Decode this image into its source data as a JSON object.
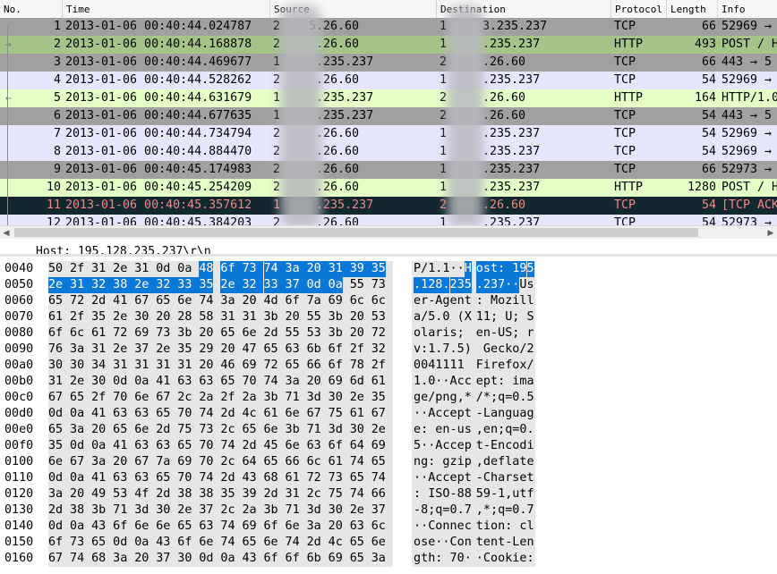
{
  "columns": [
    "No.",
    "Time",
    "Source",
    "Destination",
    "Protocol",
    "Length",
    "Info"
  ],
  "colors": {
    "row_tcp": "#e7e6ff",
    "row_http": "#e4ffc7",
    "row_gray": "#a0a0a0",
    "row_black": "#12272e",
    "row_black_text": "#f78787",
    "selection": "#0a78d7"
  },
  "packets": [
    {
      "no": "1",
      "time": "2013-01-06 00:40:44.024787",
      "source": "2    5.26.60",
      "destination": "1     3.235.237",
      "protocol": "TCP",
      "length": "66",
      "info": "52969 →",
      "style": "gray",
      "rel": ""
    },
    {
      "no": "2",
      "time": "2013-01-06 00:40:44.168878",
      "source": "2     .26.60",
      "destination": "1     .235.237",
      "protocol": "HTTP",
      "length": "493",
      "info": "POST / H",
      "style": "http_dark",
      "rel": "→"
    },
    {
      "no": "3",
      "time": "2013-01-06 00:40:44.469677",
      "source": "1     .235.237",
      "destination": "2     .26.60",
      "protocol": "TCP",
      "length": "66",
      "info": "443 → 5",
      "style": "gray",
      "rel": ""
    },
    {
      "no": "4",
      "time": "2013-01-06 00:40:44.528262",
      "source": "2     .26.60",
      "destination": "1     .235.237",
      "protocol": "TCP",
      "length": "54",
      "info": "52969 →",
      "style": "tcp",
      "rel": ""
    },
    {
      "no": "5",
      "time": "2013-01-06 00:40:44.631679",
      "source": "1     .235.237",
      "destination": "2     .26.60",
      "protocol": "HTTP",
      "length": "164",
      "info": "HTTP/1.0",
      "style": "http",
      "rel": "←"
    },
    {
      "no": "6",
      "time": "2013-01-06 00:40:44.677635",
      "source": "1     .235.237",
      "destination": "2     .26.60",
      "protocol": "TCP",
      "length": "54",
      "info": "443 → 5",
      "style": "gray",
      "rel": ""
    },
    {
      "no": "7",
      "time": "2013-01-06 00:40:44.734794",
      "source": "2     .26.60",
      "destination": "1     .235.237",
      "protocol": "TCP",
      "length": "54",
      "info": "52969 →",
      "style": "tcp",
      "rel": ""
    },
    {
      "no": "8",
      "time": "2013-01-06 00:40:44.884470",
      "source": "2     .26.60",
      "destination": "1     .235.237",
      "protocol": "TCP",
      "length": "54",
      "info": "52969 →",
      "style": "tcp",
      "rel": ""
    },
    {
      "no": "9",
      "time": "2013-01-06 00:40:45.174983",
      "source": "2     .26.60",
      "destination": "1     .235.237",
      "protocol": "TCP",
      "length": "66",
      "info": "52973 →",
      "style": "gray",
      "rel": ""
    },
    {
      "no": "10",
      "time": "2013-01-06 00:40:45.254209",
      "source": "2     .26.60",
      "destination": "1     .235.237",
      "protocol": "HTTP",
      "length": "1280",
      "info": "POST / H",
      "style": "http",
      "rel": ""
    },
    {
      "no": "11",
      "time": "2013-01-06 00:40:45.357612",
      "source": "1     .235.237",
      "destination": "2     .26.60",
      "protocol": "TCP",
      "length": "54",
      "info": "[TCP ACK",
      "style": "black",
      "rel": ""
    },
    {
      "no": "12",
      "time": "2013-01-06 00:40:45.384203",
      "source": "2     .26.60",
      "destination": "1     .235.237",
      "protocol": "TCP",
      "length": "54",
      "info": "52973 →",
      "style": "tcp",
      "rel": ""
    }
  ],
  "detail_line": "Host: 195.128.235.237\\r\\n",
  "hex_rows": [
    {
      "offset": "0040",
      "bytes": [
        "50",
        "2f",
        "31",
        "2e",
        "31",
        "0d",
        "0a",
        "48",
        "6f",
        "73",
        "74",
        "3a",
        "20",
        "31",
        "39",
        "35"
      ],
      "ascii": "P/1.1··Host: 195",
      "hl": [
        7,
        8,
        9,
        10,
        11,
        12,
        13,
        14,
        15
      ]
    },
    {
      "offset": "0050",
      "bytes": [
        "2e",
        "31",
        "32",
        "38",
        "2e",
        "32",
        "33",
        "35",
        "2e",
        "32",
        "33",
        "37",
        "0d",
        "0a",
        "55",
        "73"
      ],
      "ascii": ".128.235.237··Us",
      "hl": [
        0,
        1,
        2,
        3,
        4,
        5,
        6,
        7,
        8,
        9,
        10,
        11,
        12,
        13
      ]
    },
    {
      "offset": "0060",
      "bytes": [
        "65",
        "72",
        "2d",
        "41",
        "67",
        "65",
        "6e",
        "74",
        "3a",
        "20",
        "4d",
        "6f",
        "7a",
        "69",
        "6c",
        "6c"
      ],
      "ascii": "er-Agent: Mozill",
      "hl": []
    },
    {
      "offset": "0070",
      "bytes": [
        "61",
        "2f",
        "35",
        "2e",
        "30",
        "20",
        "28",
        "58",
        "31",
        "31",
        "3b",
        "20",
        "55",
        "3b",
        "20",
        "53"
      ],
      "ascii": "a/5.0 (X11; U; S",
      "hl": []
    },
    {
      "offset": "0080",
      "bytes": [
        "6f",
        "6c",
        "61",
        "72",
        "69",
        "73",
        "3b",
        "20",
        "65",
        "6e",
        "2d",
        "55",
        "53",
        "3b",
        "20",
        "72"
      ],
      "ascii": "olaris; en-US; r",
      "hl": []
    },
    {
      "offset": "0090",
      "bytes": [
        "76",
        "3a",
        "31",
        "2e",
        "37",
        "2e",
        "35",
        "29",
        "20",
        "47",
        "65",
        "63",
        "6b",
        "6f",
        "2f",
        "32"
      ],
      "ascii": "v:1.7.5) Gecko/2",
      "hl": []
    },
    {
      "offset": "00a0",
      "bytes": [
        "30",
        "30",
        "34",
        "31",
        "31",
        "31",
        "31",
        "20",
        "46",
        "69",
        "72",
        "65",
        "66",
        "6f",
        "78",
        "2f"
      ],
      "ascii": "0041111 Firefox/",
      "hl": []
    },
    {
      "offset": "00b0",
      "bytes": [
        "31",
        "2e",
        "30",
        "0d",
        "0a",
        "41",
        "63",
        "63",
        "65",
        "70",
        "74",
        "3a",
        "20",
        "69",
        "6d",
        "61"
      ],
      "ascii": "1.0··Accept: ima",
      "hl": []
    },
    {
      "offset": "00c0",
      "bytes": [
        "67",
        "65",
        "2f",
        "70",
        "6e",
        "67",
        "2c",
        "2a",
        "2f",
        "2a",
        "3b",
        "71",
        "3d",
        "30",
        "2e",
        "35"
      ],
      "ascii": "ge/png,*/*;q=0.5",
      "hl": []
    },
    {
      "offset": "00d0",
      "bytes": [
        "0d",
        "0a",
        "41",
        "63",
        "63",
        "65",
        "70",
        "74",
        "2d",
        "4c",
        "61",
        "6e",
        "67",
        "75",
        "61",
        "67"
      ],
      "ascii": "··Accept-Languag",
      "hl": []
    },
    {
      "offset": "00e0",
      "bytes": [
        "65",
        "3a",
        "20",
        "65",
        "6e",
        "2d",
        "75",
        "73",
        "2c",
        "65",
        "6e",
        "3b",
        "71",
        "3d",
        "30",
        "2e"
      ],
      "ascii": "e: en-us,en;q=0.",
      "hl": []
    },
    {
      "offset": "00f0",
      "bytes": [
        "35",
        "0d",
        "0a",
        "41",
        "63",
        "63",
        "65",
        "70",
        "74",
        "2d",
        "45",
        "6e",
        "63",
        "6f",
        "64",
        "69"
      ],
      "ascii": "5··Accept-Encodi",
      "hl": []
    },
    {
      "offset": "0100",
      "bytes": [
        "6e",
        "67",
        "3a",
        "20",
        "67",
        "7a",
        "69",
        "70",
        "2c",
        "64",
        "65",
        "66",
        "6c",
        "61",
        "74",
        "65"
      ],
      "ascii": "ng: gzip,deflate",
      "hl": []
    },
    {
      "offset": "0110",
      "bytes": [
        "0d",
        "0a",
        "41",
        "63",
        "63",
        "65",
        "70",
        "74",
        "2d",
        "43",
        "68",
        "61",
        "72",
        "73",
        "65",
        "74"
      ],
      "ascii": "··Accept-Charset",
      "hl": []
    },
    {
      "offset": "0120",
      "bytes": [
        "3a",
        "20",
        "49",
        "53",
        "4f",
        "2d",
        "38",
        "38",
        "35",
        "39",
        "2d",
        "31",
        "2c",
        "75",
        "74",
        "66"
      ],
      "ascii": ": ISO-8859-1,utf",
      "hl": []
    },
    {
      "offset": "0130",
      "bytes": [
        "2d",
        "38",
        "3b",
        "71",
        "3d",
        "30",
        "2e",
        "37",
        "2c",
        "2a",
        "3b",
        "71",
        "3d",
        "30",
        "2e",
        "37"
      ],
      "ascii": "-8;q=0.7,*;q=0.7",
      "hl": []
    },
    {
      "offset": "0140",
      "bytes": [
        "0d",
        "0a",
        "43",
        "6f",
        "6e",
        "6e",
        "65",
        "63",
        "74",
        "69",
        "6f",
        "6e",
        "3a",
        "20",
        "63",
        "6c"
      ],
      "ascii": "··Connection: cl",
      "hl": []
    },
    {
      "offset": "0150",
      "bytes": [
        "6f",
        "73",
        "65",
        "0d",
        "0a",
        "43",
        "6f",
        "6e",
        "74",
        "65",
        "6e",
        "74",
        "2d",
        "4c",
        "65",
        "6e"
      ],
      "ascii": "ose··Content-Len",
      "hl": []
    },
    {
      "offset": "0160",
      "bytes": [
        "67",
        "74",
        "68",
        "3a",
        "20",
        "37",
        "30",
        "0d",
        "0a",
        "43",
        "6f",
        "6f",
        "6b",
        "69",
        "65",
        "3a"
      ],
      "ascii": "gth: 70··Cookie:",
      "hl": []
    }
  ],
  "icons": {
    "scroll_left": "triangle-left-icon",
    "scroll_right": "triangle-right-icon"
  }
}
